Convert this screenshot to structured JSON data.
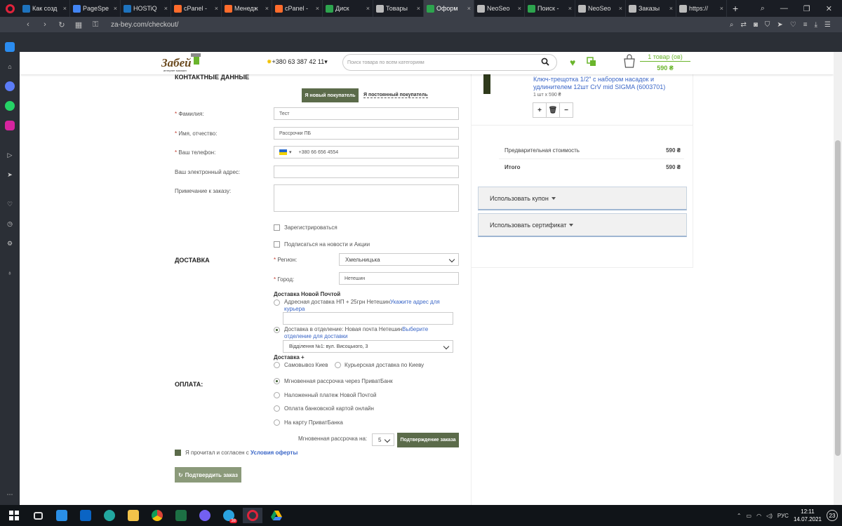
{
  "browser": {
    "tabs": [
      {
        "title": "Как созд",
        "fav_color": "#1e73be"
      },
      {
        "title": "PageSpe",
        "fav_color": "#4285f4"
      },
      {
        "title": "HOSTiQ",
        "fav_color": "#1e73be"
      },
      {
        "title": "cPanel -",
        "fav_color": "#ff6c2c"
      },
      {
        "title": "Менедж",
        "fav_color": "#ff6c2c"
      },
      {
        "title": "cPanel -",
        "fav_color": "#ff6c2c"
      },
      {
        "title": "Диск",
        "fav_color": "#2da44e"
      },
      {
        "title": "Товары",
        "fav_color": "#bbbbbb"
      },
      {
        "title": "Оформ",
        "fav_color": "#2da44e"
      },
      {
        "title": "NeoSeo",
        "fav_color": "#bbbbbb"
      },
      {
        "title": "Поиск -",
        "fav_color": "#2da44e"
      },
      {
        "title": "NeoSeo",
        "fav_color": "#bbbbbb"
      },
      {
        "title": "Заказы",
        "fav_color": "#bbbbbb"
      },
      {
        "title": "https://",
        "fav_color": "#bbbbbb"
      }
    ],
    "active_tab": 8,
    "url": "za-bey.com/checkout/"
  },
  "header": {
    "logo_text": "Забей",
    "logo_sub": "интернет магазин",
    "phone": "+380 63 387 42 11",
    "phone_arrow": "▾",
    "search_placeholder": "Поиск товара по всем категориям",
    "cart_count": "1 товар (ов)",
    "cart_total": "590 ₴"
  },
  "contacts": {
    "title": "КОНТАКТНЫЕ ДАННЫЕ",
    "tab_new": "Я новый покупатель",
    "tab_regular": "Я постоянный покупатель",
    "surname_label": "Фамилия:",
    "surname_value": "Тест",
    "name_label": "Имя, отчество:",
    "name_value": "Рассрочки ПБ",
    "phone_label": "Ваш телефон:",
    "phone_value": "+380 66 656 4554",
    "email_label": "Ваш электронный адрес:",
    "comment_label": "Примечание к заказу:",
    "register_label": "Зарегистрироваться",
    "subscribe_label": "Подписаться на новости и Акции"
  },
  "delivery": {
    "title": "ДОСТАВКА",
    "region_label": "Регион:",
    "region_value": "Хмельницька",
    "city_label": "Город:",
    "city_value": "Нетешин",
    "np_title": "Доставка Новой Почтой",
    "np_address_text": "Адресная доставка НП + 25грн Нетешин",
    "np_address_link": "Укажите адрес для курьера",
    "np_branch_text": "Доставка в отделение: Новая почта Нетешин",
    "np_branch_link": "Выберите отделение для доставки",
    "branch_value": "Відділення №1: вул. Висоцького, 3",
    "plus_title": "Доставка +",
    "pickup": "Самовывоз Киев",
    "courier": "Курьерская доставка по Киеву"
  },
  "payment": {
    "title": "ОПЛАТА:",
    "options": [
      "Мгновенная рассрочка через ПриватБанк",
      "Наложенный платеж Новой Почтой",
      "Оплата банковской картой онлайн",
      "На карту ПриватБанка"
    ],
    "selected": 0,
    "installment_label": "Мгновенная рассрочка на:",
    "installment_value": "5",
    "confirm_small": "Подтверждение заказа",
    "agree_text": "Я прочитал и согласен с ",
    "agree_link": "Условия оферты",
    "submit": "Подтвердить заказ"
  },
  "summary": {
    "product_name": "Ключ-трещотка 1/2\" с набором насадок и удлинителем 12шт CrV mid SIGMA (6003701)",
    "product_qty": "1 шт x 590 ₴",
    "pre_label": "Предварительная стоимость",
    "pre_value": "590 ₴",
    "total_label": "Итого",
    "total_value": "590 ₴",
    "coupon": "Использовать купон",
    "certificate": "Использовать сертификат"
  },
  "taskbar": {
    "lang": "РУС",
    "time": "12:11",
    "date": "14.07.2021",
    "notif": "23",
    "telegram_badge": "38"
  }
}
